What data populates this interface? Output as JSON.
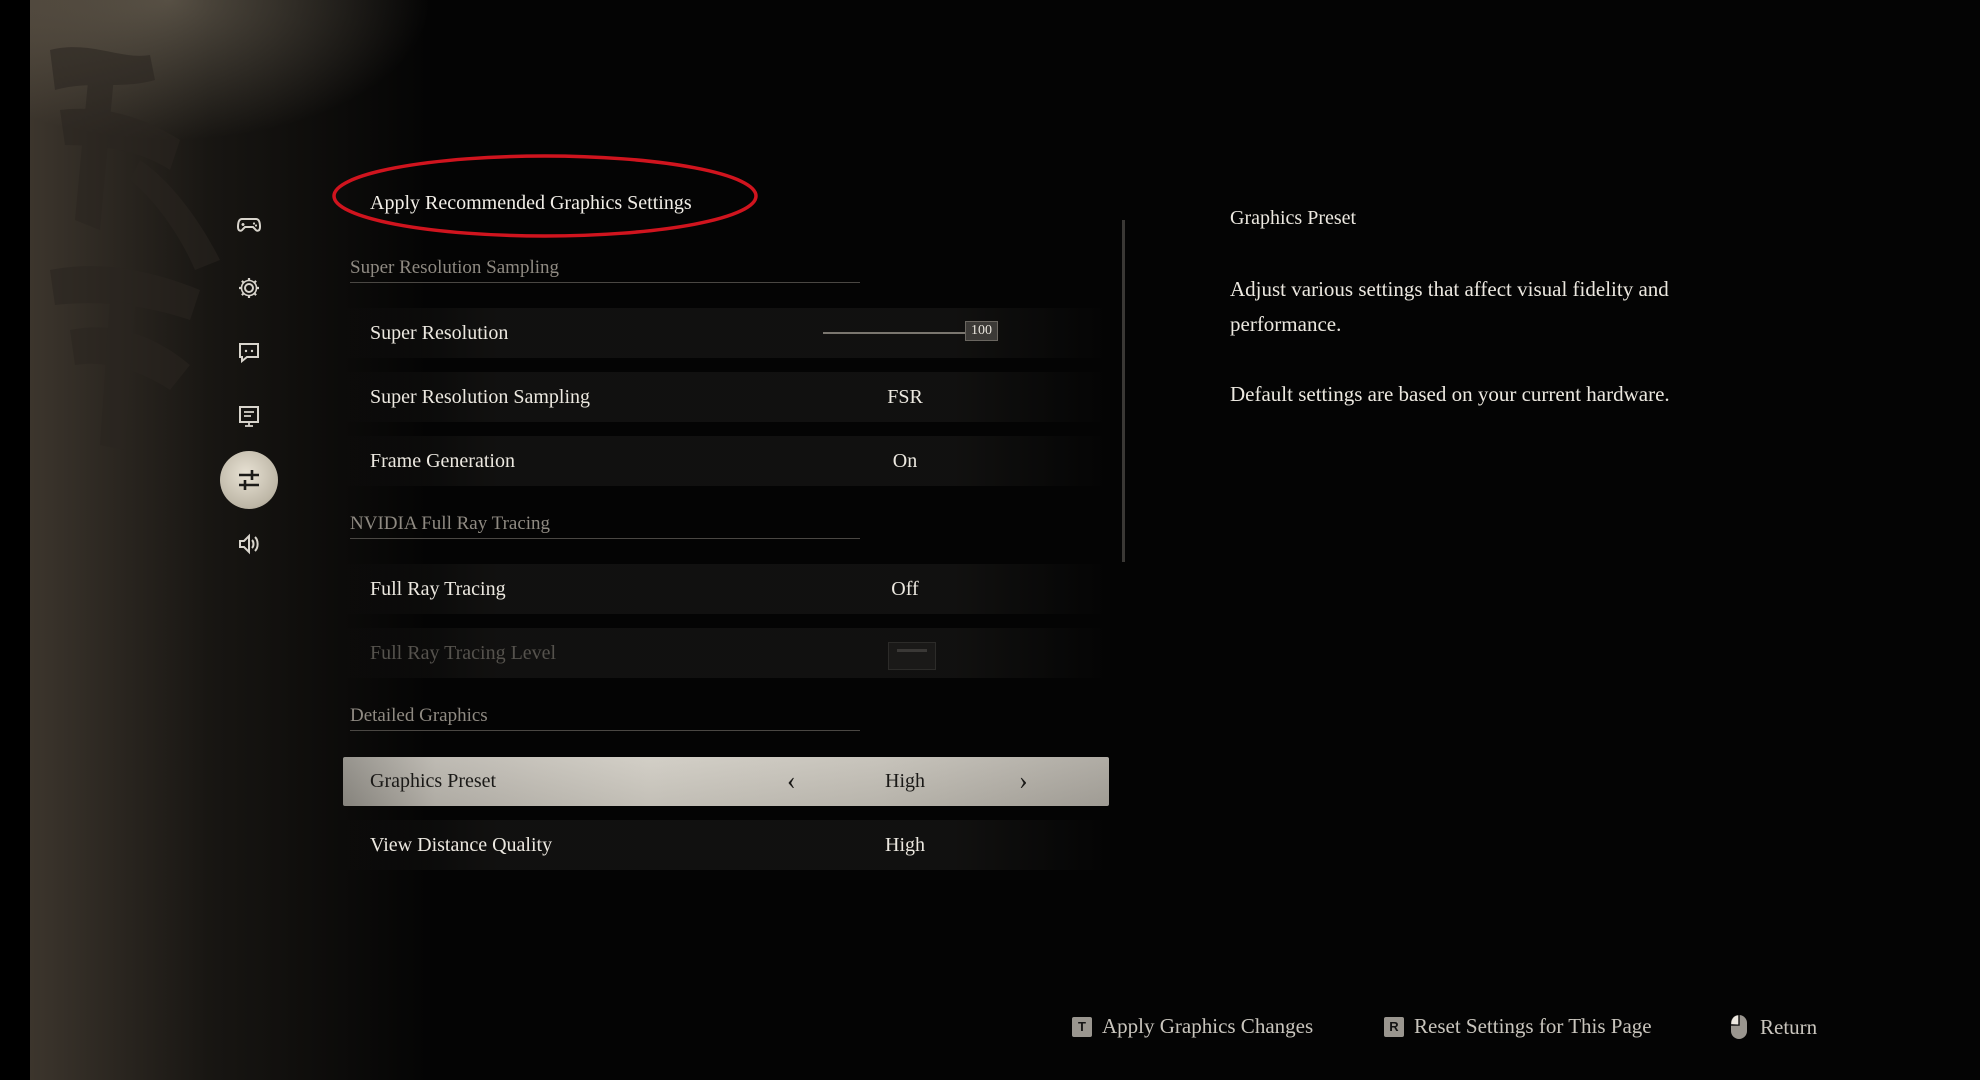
{
  "recommend": {
    "label": "Apply Recommended Graphics Settings"
  },
  "nav": [
    {
      "icon": "gamepad-icon",
      "active": false
    },
    {
      "icon": "gear-icon",
      "active": false
    },
    {
      "icon": "chat-icon",
      "active": false
    },
    {
      "icon": "display-icon",
      "active": false
    },
    {
      "icon": "sliders-icon",
      "active": true
    },
    {
      "icon": "audio-icon",
      "active": false
    }
  ],
  "sections": {
    "super_resolution_sampling": "Super Resolution Sampling",
    "ray_tracing": "NVIDIA Full Ray Tracing",
    "detailed_graphics": "Detailed Graphics"
  },
  "settings": {
    "super_resolution": {
      "label": "Super Resolution",
      "value": "100"
    },
    "super_resolution_sampling": {
      "label": "Super Resolution Sampling",
      "value": "FSR"
    },
    "frame_generation": {
      "label": "Frame Generation",
      "value": "On"
    },
    "full_ray_tracing": {
      "label": "Full Ray Tracing",
      "value": "Off"
    },
    "full_ray_tracing_level": {
      "label": "Full Ray Tracing Level"
    },
    "graphics_preset": {
      "label": "Graphics Preset",
      "value": "High"
    },
    "view_distance_quality": {
      "label": "View Distance Quality",
      "value": "High"
    }
  },
  "description": {
    "title": "Graphics Preset",
    "paragraph1": "Adjust various settings that affect visual fidelity and performance.",
    "paragraph2": "Default settings are based on your current hardware."
  },
  "footer": {
    "apply_key": "T",
    "apply_label": "Apply Graphics Changes",
    "reset_key": "R",
    "reset_label": "Reset Settings for This Page",
    "return_label": "Return"
  },
  "colors": {
    "highlight_ellipse": "#d0141e",
    "selected_row": "#c3bfb6"
  }
}
